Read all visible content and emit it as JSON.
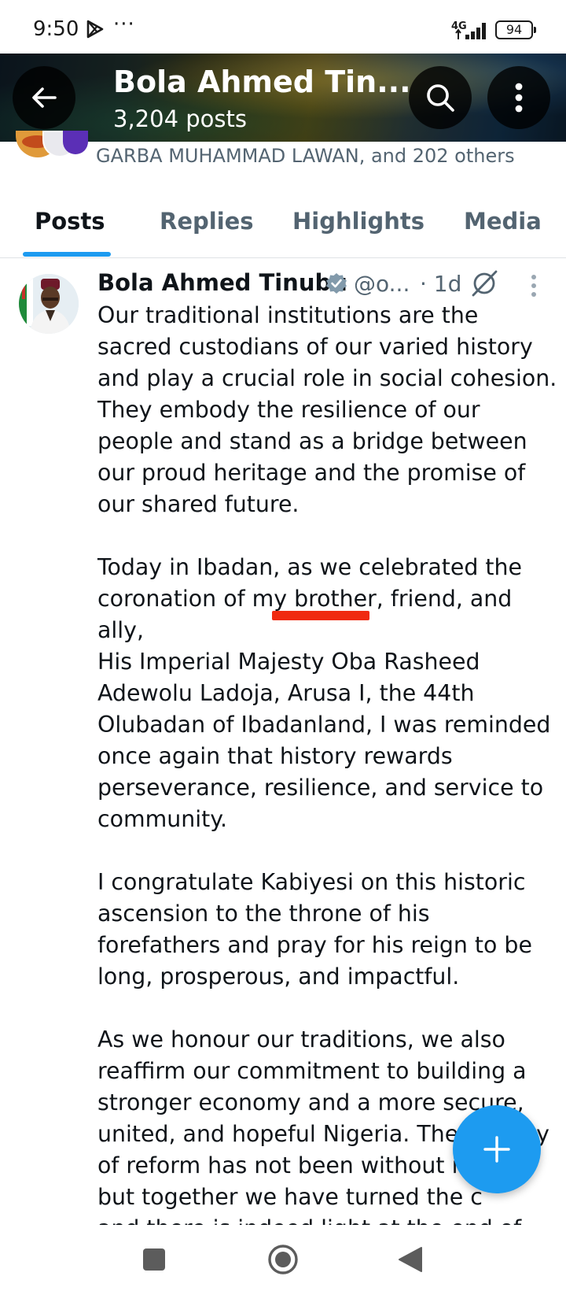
{
  "status_bar": {
    "time": "9:50",
    "dots": "···",
    "network": "4G",
    "battery": "94"
  },
  "header": {
    "title": "Bola Ahmed Tin...",
    "post_count": "3,204 posts"
  },
  "followers": {
    "text": "GARBA MUHAMMAD LAWAN, and 202 others"
  },
  "tabs": [
    {
      "label": "Posts",
      "active": true
    },
    {
      "label": "Replies",
      "active": false
    },
    {
      "label": "Highlights",
      "active": false
    },
    {
      "label": "Media",
      "active": false
    }
  ],
  "post": {
    "author": "Bola Ahmed Tinubu",
    "handle": "@o...",
    "time": "· 1d",
    "body": "Our traditional institutions are the\nsacred custodians of our varied history\nand play a crucial role in social cohesion.\nThey embody the resilience of our\npeople and stand as a bridge between\nour proud heritage and the promise of\nour shared future.\n\nToday in Ibadan, as we celebrated the\ncoronation of my brother, friend, and ally,\nHis Imperial Majesty  Oba Rasheed\nAdewolu Ladoja, Arusa I, the 44th\nOlubadan of Ibadanland, I was reminded\nonce again that history rewards\nperseverance, resilience, and service to\ncommunity.\n\nI congratulate Kabiyesi on this historic\nascension to the throne of his\nforefathers and pray for his reign to be\nlong, prosperous, and impactful.\n\nAs we honour our traditions, we also\nreaffirm our commitment to building a\nstronger economy and a more secure,\nunited, and hopeful Nigeria. The journey\nof reform has not been without its\nbut together we have turned the c\nand there is indeed light at the end of"
  },
  "colors": {
    "accent": "#1d9bf0",
    "secondary_text": "#536471",
    "primary_text": "#0f1419",
    "annotation": "#f02a10"
  },
  "icons": {
    "back": "arrow-left-icon",
    "search": "search-icon",
    "more": "more-vertical-icon",
    "verified": "verified-badge-icon",
    "grok": "grok-icon",
    "compose": "plus-icon"
  }
}
